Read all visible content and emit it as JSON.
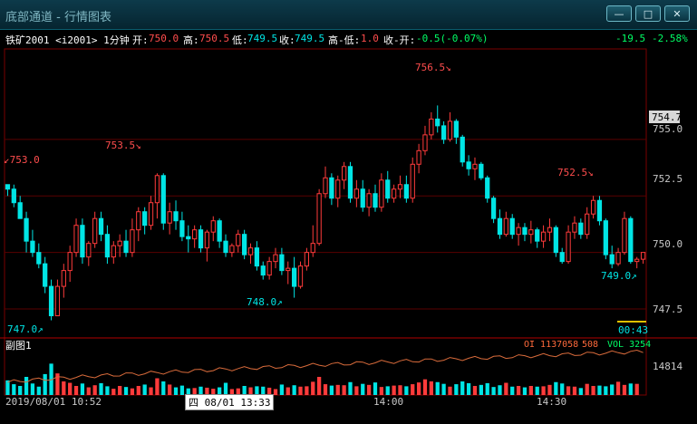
{
  "window": {
    "title": "底部通道 - 行情图表",
    "btn_min": "—",
    "btn_max": "□",
    "btn_close": "✕"
  },
  "info": {
    "instrument": "铁矿2001 <i2001> 1分钟",
    "open_label": "开:",
    "open_value": "750.0",
    "high_label": "高:",
    "high_value": "750.5",
    "low_label": "低:",
    "low_value": "749.5",
    "close_label": "收:",
    "close_value": "749.5",
    "hl_label": "高-低:",
    "hl_value": "1.0",
    "co_label": "收-开:",
    "co_value": "-0.5(-0.07%)",
    "change": "-19.5",
    "change_pct": "-2.58%"
  },
  "price_axis": {
    "ticks": [
      "755.0",
      "752.5",
      "750.0",
      "747.5"
    ],
    "last_price": "754.7"
  },
  "annotations": {
    "a753": "753.0",
    "a7535": "753.5",
    "a7565": "756.5",
    "a7525": "752.5",
    "a747": "747.0",
    "a748": "748.0",
    "a749": "749.0"
  },
  "countdown": "00:43",
  "subchart": {
    "title": "副图1",
    "oi_label": "OI 1137058",
    "oi_value": "508",
    "vol_label": "VOL 3254",
    "axis_tick": "14814"
  },
  "time_axis": {
    "start": "2019/08/01 10:52",
    "cursor": "四 08/01 13:33",
    "t1400": "14:00",
    "t1430": "14:30"
  },
  "colors": {
    "up": "#ff3b3b",
    "down": "#00e5e5",
    "oi_line": "#d96b3b",
    "grid": "#5a0000"
  },
  "chart_data": {
    "type": "candlestick",
    "ylim": [
      746.3,
      759.0
    ],
    "candles": [
      [
        753,
        753,
        752.5,
        752.8
      ],
      [
        752.8,
        753,
        752,
        752.2
      ],
      [
        752.2,
        752.5,
        751.5,
        751.5
      ],
      [
        751.5,
        751.8,
        750,
        750.5
      ],
      [
        750.5,
        751,
        749.8,
        750
      ],
      [
        750,
        750.4,
        749.3,
        749.5
      ],
      [
        749.5,
        749.8,
        748.2,
        748.5
      ],
      [
        748.5,
        748.8,
        747,
        747.2
      ],
      [
        747.2,
        748.8,
        747.2,
        748.5
      ],
      [
        748.5,
        749.5,
        748,
        749.2
      ],
      [
        749.2,
        750.3,
        748.7,
        750
      ],
      [
        750,
        751.5,
        749.8,
        751.2
      ],
      [
        751.2,
        751.5,
        749.5,
        749.8
      ],
      [
        749.8,
        750.5,
        749.4,
        750.4
      ],
      [
        750.4,
        751.8,
        750.2,
        751.5
      ],
      [
        751.5,
        751.8,
        750.5,
        750.8
      ],
      [
        750.8,
        751.2,
        749.5,
        749.8
      ],
      [
        749.8,
        750.5,
        749.5,
        750.3
      ],
      [
        750.3,
        750.8,
        749.8,
        750.5
      ],
      [
        750.5,
        751,
        749.8,
        750
      ],
      [
        750,
        751.5,
        749.8,
        751
      ],
      [
        751,
        752,
        750.5,
        751.8
      ],
      [
        751.8,
        752,
        750.8,
        751.2
      ],
      [
        751.2,
        752.5,
        751,
        752.2
      ],
      [
        752.2,
        753.5,
        751.5,
        753.4
      ],
      [
        753.4,
        753.5,
        751,
        751.3
      ],
      [
        751.3,
        752.2,
        750.8,
        751.8
      ],
      [
        751.8,
        752.3,
        751,
        751.4
      ],
      [
        751.4,
        751.8,
        750.5,
        750.7
      ],
      [
        750.7,
        751.2,
        750,
        750.6
      ],
      [
        750.6,
        751.2,
        750.2,
        751
      ],
      [
        751,
        751.2,
        750,
        750.2
      ],
      [
        750.2,
        751,
        749.6,
        750.9
      ],
      [
        750.9,
        751.6,
        750.5,
        751.4
      ],
      [
        751.4,
        751.5,
        750.2,
        750.5
      ],
      [
        750.5,
        750.8,
        749.8,
        750
      ],
      [
        750,
        750.4,
        749.8,
        750.3
      ],
      [
        750.3,
        751,
        750,
        750.8
      ],
      [
        750.8,
        751,
        749.7,
        749.9
      ],
      [
        749.9,
        750.4,
        749.5,
        750.2
      ],
      [
        750.2,
        750.5,
        749.2,
        749.4
      ],
      [
        749.4,
        749.6,
        748.8,
        749
      ],
      [
        749,
        749.8,
        748.8,
        749.6
      ],
      [
        749.6,
        750.2,
        749.3,
        749.9
      ],
      [
        749.9,
        750.2,
        749,
        749.2
      ],
      [
        749.2,
        749.6,
        748.6,
        749.3
      ],
      [
        749.3,
        749.8,
        748,
        748.5
      ],
      [
        748.5,
        749.6,
        748.4,
        749.4
      ],
      [
        749.4,
        750.2,
        749.2,
        750
      ],
      [
        750,
        751.2,
        749.8,
        750.4
      ],
      [
        750.4,
        752.8,
        750.3,
        752.6
      ],
      [
        752.6,
        753.8,
        752.4,
        753.3
      ],
      [
        753.3,
        753.5,
        752.1,
        752.4
      ],
      [
        752.4,
        753.4,
        752,
        753.2
      ],
      [
        753.2,
        754,
        752.8,
        753.8
      ],
      [
        753.8,
        754,
        752.2,
        752.4
      ],
      [
        752.4,
        753.2,
        752,
        752.8
      ],
      [
        752.8,
        753.2,
        751.8,
        752
      ],
      [
        752,
        752.8,
        751.6,
        752.6
      ],
      [
        752.6,
        753,
        751.8,
        752
      ],
      [
        752,
        753.5,
        751.8,
        753.2
      ],
      [
        753.2,
        753.6,
        752.2,
        752.4
      ],
      [
        752.4,
        753,
        752.2,
        752.8
      ],
      [
        752.8,
        753.4,
        752.4,
        753
      ],
      [
        753,
        753.4,
        752.2,
        752.4
      ],
      [
        752.4,
        754.2,
        752.2,
        753.9
      ],
      [
        753.9,
        754.8,
        753.5,
        754.5
      ],
      [
        754.5,
        755.6,
        754.3,
        755.2
      ],
      [
        755.2,
        756.2,
        755,
        755.9
      ],
      [
        755.9,
        756.5,
        755.3,
        755.6
      ],
      [
        755.6,
        755.8,
        754.8,
        755
      ],
      [
        755,
        756.2,
        754.9,
        755.8
      ],
      [
        755.8,
        755.9,
        754.8,
        755.1
      ],
      [
        755.1,
        755.2,
        753.8,
        754
      ],
      [
        754,
        754.3,
        753.4,
        753.7
      ],
      [
        753.7,
        754.2,
        753.2,
        753.9
      ],
      [
        753.9,
        754,
        753.2,
        753.3
      ],
      [
        753.3,
        753.4,
        752.2,
        752.4
      ],
      [
        752.4,
        752.5,
        751.3,
        751.5
      ],
      [
        751.5,
        751.9,
        750.6,
        750.8
      ],
      [
        750.8,
        751.8,
        750.7,
        751.5
      ],
      [
        751.5,
        751.7,
        750.6,
        750.8
      ],
      [
        750.8,
        751.3,
        750.3,
        751.1
      ],
      [
        751.1,
        751.3,
        750.5,
        750.8
      ],
      [
        750.8,
        751.4,
        750.4,
        751
      ],
      [
        751,
        751.1,
        750.2,
        750.5
      ],
      [
        750.5,
        751.2,
        750.2,
        750.9
      ],
      [
        750.9,
        751.5,
        750.5,
        751.1
      ],
      [
        751.1,
        751.2,
        749.8,
        750
      ],
      [
        750,
        750.2,
        749.5,
        749.6
      ],
      [
        749.6,
        751.2,
        749.5,
        750.9
      ],
      [
        750.9,
        751.6,
        750.6,
        751.3
      ],
      [
        751.3,
        751.5,
        750.6,
        750.8
      ],
      [
        750.8,
        752,
        750.6,
        751.7
      ],
      [
        751.7,
        752.5,
        751.5,
        752.3
      ],
      [
        752.3,
        752.5,
        751.2,
        751.4
      ],
      [
        751.4,
        751.5,
        749.7,
        749.9
      ],
      [
        749.9,
        750.3,
        749.3,
        749.5
      ],
      [
        749.5,
        750.2,
        749.4,
        750
      ],
      [
        750,
        751.8,
        749.9,
        751.5
      ],
      [
        751.5,
        751.6,
        749.5,
        749.6
      ],
      [
        749.6,
        749.8,
        749.3,
        749.7
      ],
      [
        749.7,
        750,
        749.5,
        750
      ]
    ],
    "volume": [
      4200,
      3100,
      2600,
      5200,
      3300,
      2400,
      6000,
      9000,
      6200,
      3900,
      3500,
      2600,
      3300,
      2200,
      2800,
      3400,
      2500,
      1800,
      2600,
      2300,
      1900,
      2600,
      3000,
      2200,
      4800,
      3900,
      3000,
      2200,
      2700,
      1900,
      2000,
      2400,
      2100,
      1800,
      2200,
      3500,
      1700,
      1900,
      2600,
      2200,
      2500,
      2400,
      2100,
      1700,
      3000,
      2200,
      2800,
      2400,
      2500,
      3800,
      5200,
      3100,
      2700,
      2900,
      2800,
      3700,
      2500,
      3200,
      2900,
      3600,
      2300,
      2500,
      2700,
      2800,
      2500,
      3100,
      3600,
      4500,
      3900,
      3700,
      3200,
      2400,
      3100,
      3900,
      3400,
      2600,
      2900,
      3400,
      2300,
      2800,
      3500,
      2400,
      2600,
      2200,
      2600,
      2400,
      2500,
      2900,
      3700,
      3300,
      2500,
      2400,
      2000,
      3200,
      2600,
      2700,
      2500,
      3000,
      3800,
      2900,
      3300,
      3200
    ],
    "oi_range": [
      1136600,
      1137090
    ],
    "volume_ylim": [
      0,
      14814
    ]
  }
}
